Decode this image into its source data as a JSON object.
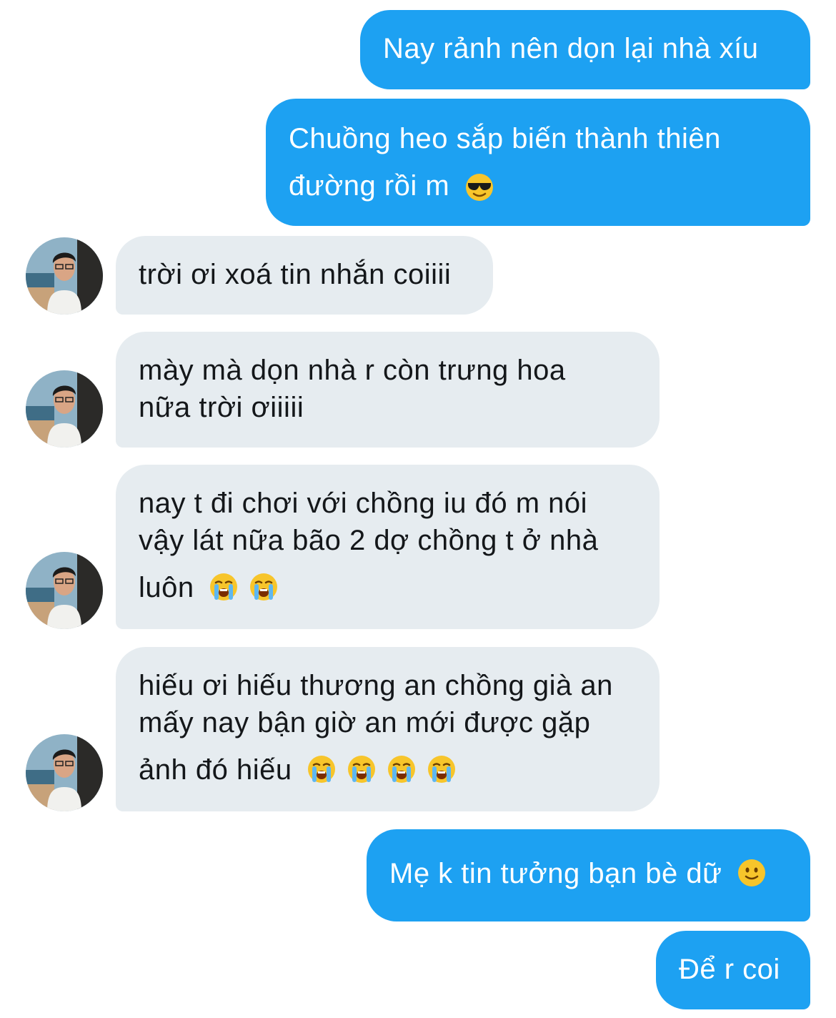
{
  "messages": [
    {
      "side": "out",
      "lines": [
        "Nay rảnh nên dọn lại nhà xíu"
      ]
    },
    {
      "side": "out",
      "lines": [
        "Chuồng heo sắp biến thành thiên",
        "đường rồi m"
      ],
      "emoji": "smiling-face-with-sunglasses"
    },
    {
      "side": "in",
      "lines": [
        "trời ơi xoá tin nhắn coiiii"
      ]
    },
    {
      "side": "in",
      "lines": [
        "mày mà dọn nhà r còn trưng hoa",
        "nữa trời ơiiiii"
      ]
    },
    {
      "side": "in",
      "lines": [
        "nay t đi chơi với chồng iu đó m nói",
        "vậy lát nữa bão 2 dợ chồng t ở nhà",
        "luôn"
      ],
      "emoji": "loudly-crying-face",
      "emoji_count": 2
    },
    {
      "side": "in",
      "lines": [
        "hiếu ơi hiếu thương an chồng già an",
        "mấy nay bận giờ an mới được gặp",
        "ảnh đó hiếu"
      ],
      "emoji": "loudly-crying-face",
      "emoji_count": 4
    },
    {
      "side": "out",
      "lines": [
        "Mẹ k tin tưởng bạn bè dữ"
      ],
      "emoji": "slightly-smiling-face"
    },
    {
      "side": "out",
      "lines": [
        "Để r coi"
      ]
    }
  ],
  "colors": {
    "outgoing_bubble": "#1da1f2",
    "incoming_bubble": "#e6ecf0",
    "outgoing_text": "#ffffff",
    "incoming_text": "#14171a"
  }
}
